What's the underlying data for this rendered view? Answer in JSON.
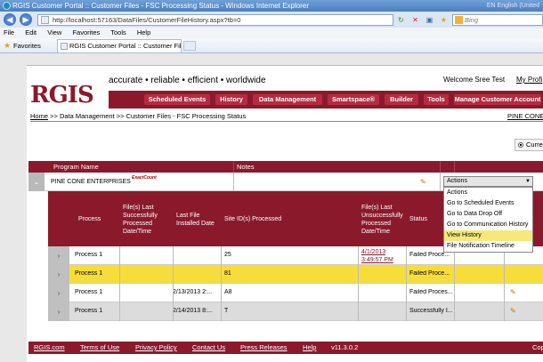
{
  "window": {
    "title": "RGIS Customer Portal :: Customer Files - FSC Processing Status - Windows Internet Explorer",
    "title_right": "EN English (United"
  },
  "addressbar": {
    "url": "http://localhost:57163/DataFiles/CustomerFileHistory.aspx?tb=0",
    "search_placeholder": "Bing"
  },
  "menubar": [
    "File",
    "Edit",
    "View",
    "Favorites",
    "Tools",
    "Help"
  ],
  "favbar": {
    "favorites_label": "Favorites",
    "tab_label": "RGIS Customer Portal :: Customer Files - FSC Pro..."
  },
  "header": {
    "logo": "RGIS",
    "tagline": "accurate • reliable • efficient • worldwide",
    "welcome": "Welcome Sree Test",
    "my_profile": "My Profi",
    "nav": [
      "Scheduled Events",
      "History",
      "Data Management",
      "Smartspace®",
      "Builder",
      "Tools",
      "Manage Customer Account"
    ]
  },
  "breadcrumb": {
    "home": "Home",
    "rest": " >> Data Management >> Customer Files - FSC Processing Status",
    "right_link": "PINE CONE"
  },
  "radio": {
    "label": "Curre"
  },
  "outer_grid": {
    "headers": [
      "Program Name",
      "Notes"
    ],
    "row": {
      "name": "PINE CONE ENTERPRISES",
      "logo_text": "ExactCount"
    }
  },
  "actions": {
    "selected": "Actions",
    "options": [
      "Actions",
      "Go to Scheduled Events",
      "Go to Data Drop Off",
      "Go to Communication History",
      "View History",
      "File Notification Timeline"
    ],
    "highlighted": "View History"
  },
  "inner_grid": {
    "headers": {
      "process": "Process",
      "last_success": "File(s) Last Successfully Processed Date/Time",
      "last_installed": "Last File Installed Date",
      "sites": "Site ID(s) Processed",
      "last_unsuccess": "File(s) Last Unsuccessfully Processed Date/Time",
      "status": "Status"
    },
    "rows": [
      {
        "process": "Process 1",
        "last_success": "",
        "installed": "",
        "sites": "25",
        "unsuccess_date": "4/1/2013",
        "unsuccess_time": "3:49:57 PM",
        "status": "Failed Proce..."
      },
      {
        "process": "Process 1",
        "last_success": "",
        "installed": "",
        "sites": "81",
        "unsuccess_date": "",
        "unsuccess_time": "",
        "status": "Failed Proce..."
      },
      {
        "process": "Process 1",
        "last_success": "",
        "installed": "2/13/2013 2:...",
        "sites": "A8",
        "unsuccess_date": "",
        "unsuccess_time": "",
        "status": "Failed Proces..."
      },
      {
        "process": "Process 1",
        "last_success": "",
        "installed": "2/14/2013 8:...",
        "sites": "T",
        "unsuccess_date": "",
        "unsuccess_time": "",
        "status": "Successfully I..."
      }
    ]
  },
  "footer": {
    "links": [
      "RGIS.com",
      "Terms of Use",
      "Privacy Policy",
      "Contact Us",
      "Press Releases",
      "Help"
    ],
    "version": "v11.3.0.2",
    "copy": "Cop"
  }
}
